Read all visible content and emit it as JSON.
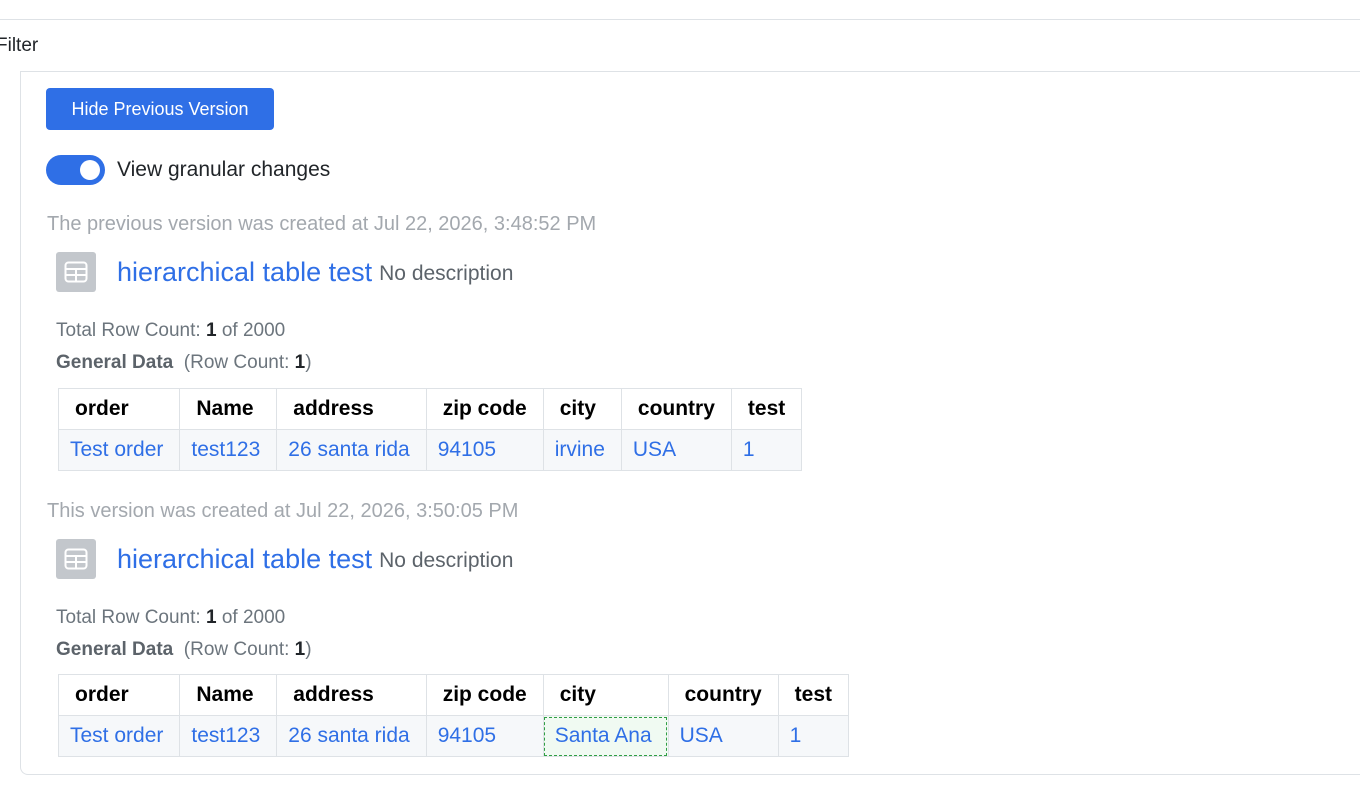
{
  "filter_label": "Filter",
  "hide_button_label": "Hide Previous Version",
  "toggle": {
    "label": "View granular changes",
    "on": true
  },
  "accent_color": "#2f6fe6",
  "previous": {
    "note": "The previous version was created at Jul 22, 2026, 3:48:52 PM",
    "title": "hierarchical table test",
    "description": "No description",
    "rowcount_prefix": "Total Row Count: ",
    "rowcount_value": "1",
    "rowcount_suffix": " of 2000",
    "section_title": "General Data",
    "section_count_prefix": "(Row Count: ",
    "section_count_value": "1",
    "section_count_suffix": ")",
    "columns": [
      "order",
      "Name",
      "address",
      "zip code",
      "city",
      "country",
      "test"
    ],
    "rows": [
      [
        "Test order",
        "test123",
        "26 santa rida",
        "94105",
        "irvine",
        "USA",
        "1"
      ]
    ]
  },
  "current": {
    "note": "This version was created at Jul 22, 2026, 3:50:05 PM",
    "title": "hierarchical table test",
    "description": "No description",
    "rowcount_prefix": "Total Row Count: ",
    "rowcount_value": "1",
    "rowcount_suffix": " of 2000",
    "section_title": "General Data",
    "section_count_prefix": "(Row Count: ",
    "section_count_value": "1",
    "section_count_suffix": ")",
    "columns": [
      "order",
      "Name",
      "address",
      "zip code",
      "city",
      "country",
      "test"
    ],
    "rows": [
      [
        "Test order",
        "test123",
        "26 santa rida",
        "94105",
        "Santa Ana",
        "USA",
        "1"
      ]
    ],
    "changed_cell": "city"
  }
}
